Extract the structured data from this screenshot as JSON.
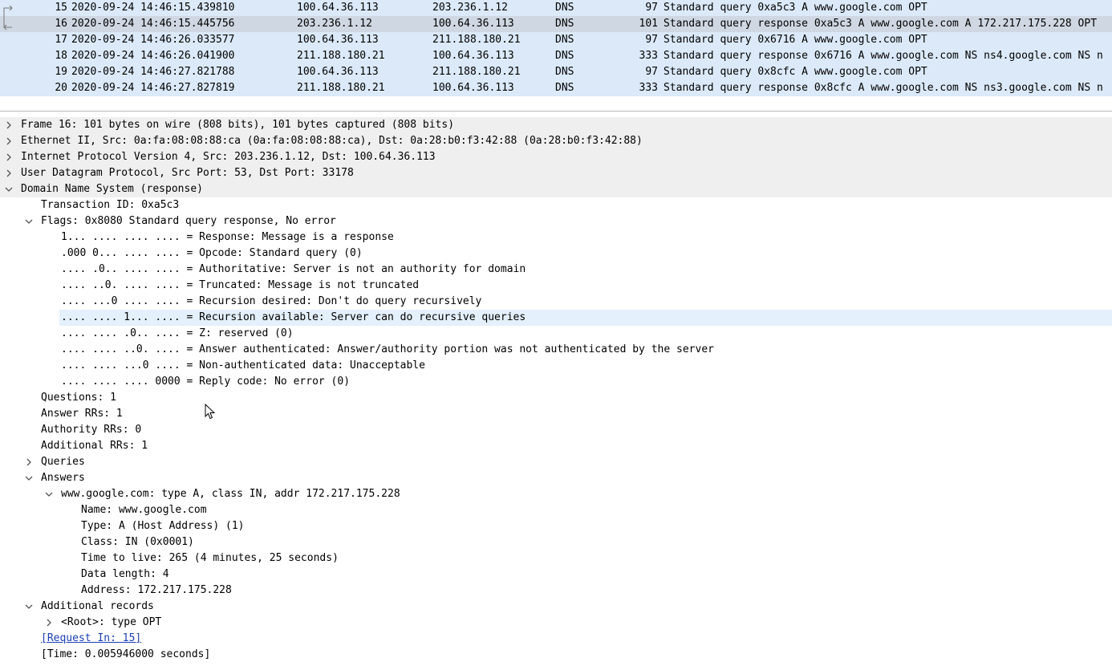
{
  "packet_list": {
    "rows": [
      {
        "no": "15",
        "time": "2020-09-24 14:46:15.439810",
        "src": "100.64.36.113",
        "dst": "203.236.1.12",
        "proto": "DNS",
        "len": "97",
        "info": "Standard query 0xa5c3 A www.google.com OPT",
        "marker": "request",
        "selected": false
      },
      {
        "no": "16",
        "time": "2020-09-24 14:46:15.445756",
        "src": "203.236.1.12",
        "dst": "100.64.36.113",
        "proto": "DNS",
        "len": "101",
        "info": "Standard query response 0xa5c3 A www.google.com A 172.217.175.228 OPT",
        "marker": "response",
        "selected": true
      },
      {
        "no": "17",
        "time": "2020-09-24 14:46:26.033577",
        "src": "100.64.36.113",
        "dst": "211.188.180.21",
        "proto": "DNS",
        "len": "97",
        "info": "Standard query 0x6716 A www.google.com OPT",
        "marker": "",
        "selected": false
      },
      {
        "no": "18",
        "time": "2020-09-24 14:46:26.041900",
        "src": "211.188.180.21",
        "dst": "100.64.36.113",
        "proto": "DNS",
        "len": "333",
        "info": "Standard query response 0x6716 A www.google.com NS ns4.google.com NS n",
        "marker": "",
        "selected": false
      },
      {
        "no": "19",
        "time": "2020-09-24 14:46:27.821788",
        "src": "100.64.36.113",
        "dst": "211.188.180.21",
        "proto": "DNS",
        "len": "97",
        "info": "Standard query 0x8cfc A www.google.com OPT",
        "marker": "",
        "selected": false
      },
      {
        "no": "20",
        "time": "2020-09-24 14:46:27.827819",
        "src": "211.188.180.21",
        "dst": "100.64.36.113",
        "proto": "DNS",
        "len": "333",
        "info": "Standard query response 0x8cfc A www.google.com NS ns3.google.com NS n",
        "marker": "",
        "selected": false
      }
    ]
  },
  "details": {
    "rows": [
      {
        "level": 0,
        "toggle": "collapsed",
        "text": "Frame 16: 101 bytes on wire (808 bits), 101 bytes captured (808 bits)",
        "name": "tree-frame"
      },
      {
        "level": 0,
        "toggle": "collapsed",
        "text": "Ethernet II, Src: 0a:fa:08:08:88:ca (0a:fa:08:08:88:ca), Dst: 0a:28:b0:f3:42:88 (0a:28:b0:f3:42:88)",
        "name": "tree-ethernet"
      },
      {
        "level": 0,
        "toggle": "collapsed",
        "text": "Internet Protocol Version 4, Src: 203.236.1.12, Dst: 100.64.36.113",
        "name": "tree-ipv4"
      },
      {
        "level": 0,
        "toggle": "collapsed",
        "text": "User Datagram Protocol, Src Port: 53, Dst Port: 33178",
        "name": "tree-udp"
      },
      {
        "level": 0,
        "toggle": "expanded",
        "text": "Domain Name System (response)",
        "name": "tree-dns"
      },
      {
        "level": 1,
        "toggle": "",
        "text": "Transaction ID: 0xa5c3",
        "name": "tree-transaction-id"
      },
      {
        "level": 1,
        "toggle": "expanded",
        "text": "Flags: 0x8080 Standard query response, No error",
        "name": "tree-flags"
      },
      {
        "level": 2,
        "toggle": "",
        "text": "1... .... .... .... = Response: Message is a response",
        "name": "tree-flag-response"
      },
      {
        "level": 2,
        "toggle": "",
        "text": ".000 0... .... .... = Opcode: Standard query (0)",
        "name": "tree-flag-opcode"
      },
      {
        "level": 2,
        "toggle": "",
        "text": ".... .0.. .... .... = Authoritative: Server is not an authority for domain",
        "name": "tree-flag-authoritative"
      },
      {
        "level": 2,
        "toggle": "",
        "text": ".... ..0. .... .... = Truncated: Message is not truncated",
        "name": "tree-flag-truncated"
      },
      {
        "level": 2,
        "toggle": "",
        "text": ".... ...0 .... .... = Recursion desired: Don't do query recursively",
        "name": "tree-flag-recursion-desired"
      },
      {
        "level": 2,
        "toggle": "",
        "text": ".... .... 1... .... = Recursion available: Server can do recursive queries",
        "name": "tree-flag-recursion-available",
        "hover": true
      },
      {
        "level": 2,
        "toggle": "",
        "text": ".... .... .0.. .... = Z: reserved (0)",
        "name": "tree-flag-z"
      },
      {
        "level": 2,
        "toggle": "",
        "text": ".... .... ..0. .... = Answer authenticated: Answer/authority portion was not authenticated by the server",
        "name": "tree-flag-answer-authenticated"
      },
      {
        "level": 2,
        "toggle": "",
        "text": ".... .... ...0 .... = Non-authenticated data: Unacceptable",
        "name": "tree-flag-non-authenticated"
      },
      {
        "level": 2,
        "toggle": "",
        "text": ".... .... .... 0000 = Reply code: No error (0)",
        "name": "tree-flag-reply-code"
      },
      {
        "level": 1,
        "toggle": "",
        "text": "Questions: 1",
        "name": "tree-questions"
      },
      {
        "level": 1,
        "toggle": "",
        "text": "Answer RRs: 1",
        "name": "tree-answer-rrs"
      },
      {
        "level": 1,
        "toggle": "",
        "text": "Authority RRs: 0",
        "name": "tree-authority-rrs"
      },
      {
        "level": 1,
        "toggle": "",
        "text": "Additional RRs: 1",
        "name": "tree-additional-rrs"
      },
      {
        "level": 1,
        "toggle": "collapsed",
        "text": "Queries",
        "name": "tree-queries"
      },
      {
        "level": 1,
        "toggle": "expanded",
        "text": "Answers",
        "name": "tree-answers"
      },
      {
        "level": 2,
        "toggle": "expanded",
        "text": "www.google.com: type A, class IN, addr 172.217.175.228",
        "name": "tree-answer-record"
      },
      {
        "level": 3,
        "toggle": "",
        "text": "Name: www.google.com",
        "name": "tree-answer-name"
      },
      {
        "level": 3,
        "toggle": "",
        "text": "Type: A (Host Address) (1)",
        "name": "tree-answer-type"
      },
      {
        "level": 3,
        "toggle": "",
        "text": "Class: IN (0x0001)",
        "name": "tree-answer-class"
      },
      {
        "level": 3,
        "toggle": "",
        "text": "Time to live: 265 (4 minutes, 25 seconds)",
        "name": "tree-answer-ttl"
      },
      {
        "level": 3,
        "toggle": "",
        "text": "Data length: 4",
        "name": "tree-answer-data-length"
      },
      {
        "level": 3,
        "toggle": "",
        "text": "Address: 172.217.175.228",
        "name": "tree-answer-address"
      },
      {
        "level": 1,
        "toggle": "expanded",
        "text": "Additional records",
        "name": "tree-additional-records"
      },
      {
        "level": 2,
        "toggle": "collapsed",
        "text": "<Root>: type OPT",
        "name": "tree-root-opt"
      },
      {
        "level": 1,
        "toggle": "",
        "text": "[Request In: 15]",
        "name": "tree-request-in-link",
        "link": true
      },
      {
        "level": 1,
        "toggle": "",
        "text": "[Time: 0.005946000 seconds]",
        "name": "tree-time"
      }
    ]
  },
  "colors": {
    "packet_row_bg": "#dbe9f8",
    "packet_selected_bg": "#cfd8e2",
    "tree_top_bg": "#efefef",
    "hover_bg": "#e4f0fb",
    "link": "#1a3fb3"
  },
  "icons": {
    "collapsed": "chevron-right-icon",
    "expanded": "chevron-down-icon",
    "request_marker": "request-arrow-icon",
    "response_marker": "response-arrow-icon",
    "cursor": "mouse-pointer-icon"
  }
}
